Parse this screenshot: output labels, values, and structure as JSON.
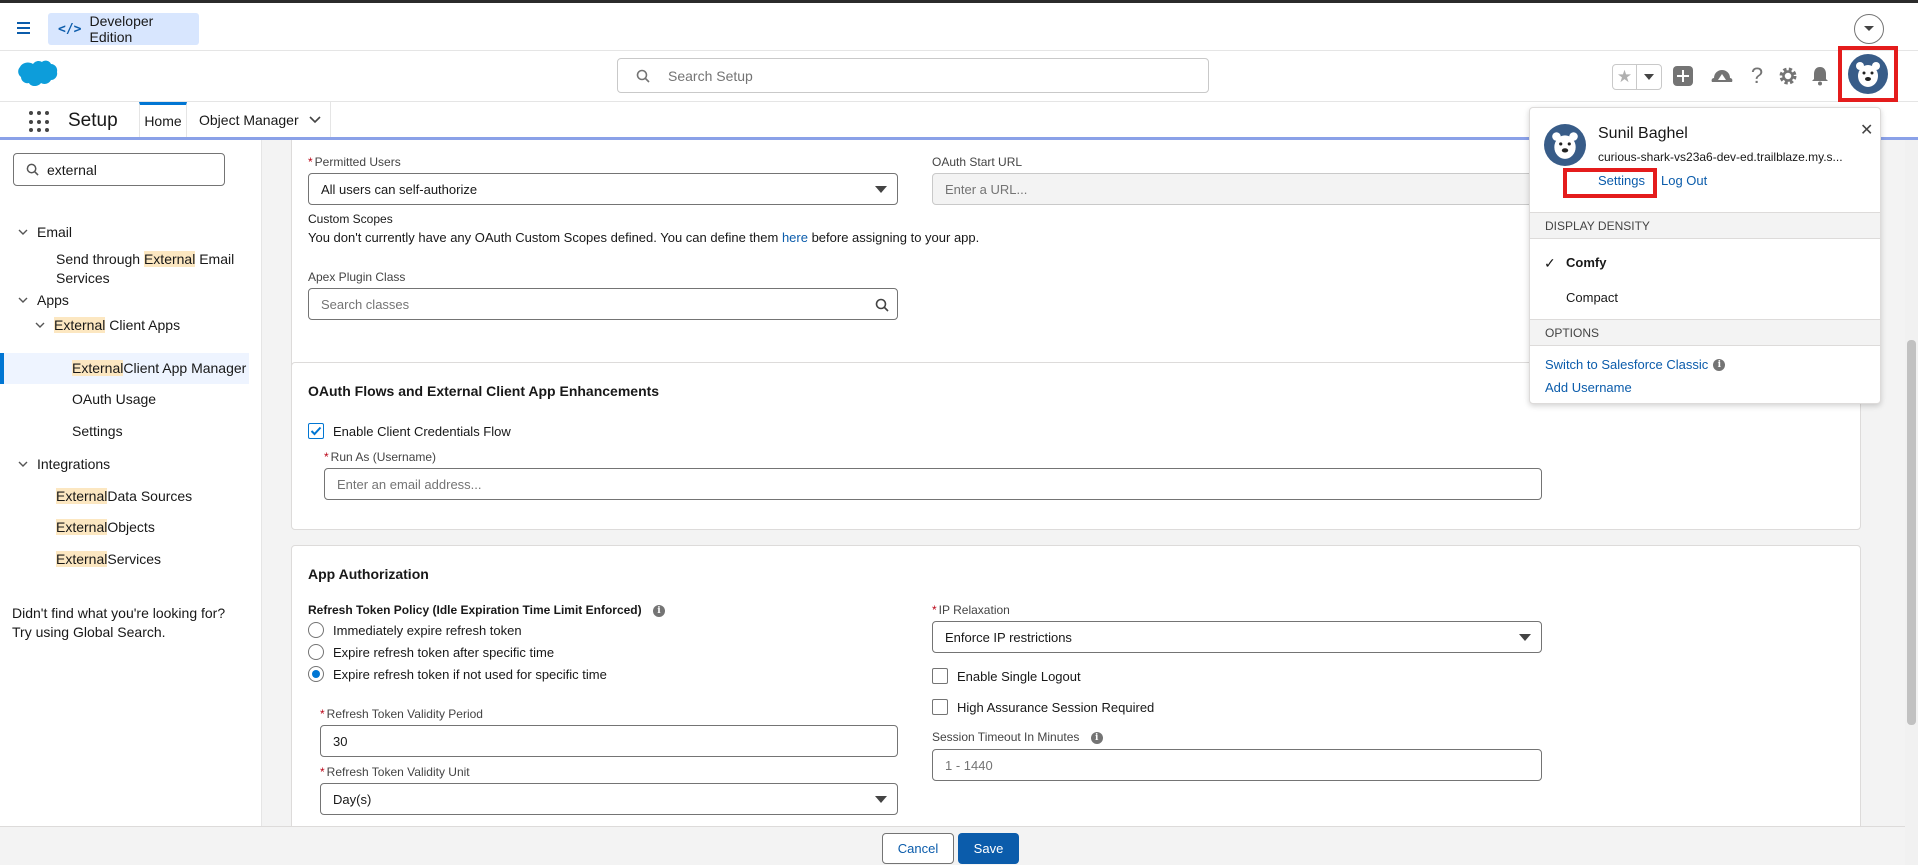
{
  "topbar": {
    "edition_label": "Developer Edition",
    "edition_icon": "</>"
  },
  "header": {
    "search_placeholder": "Search Setup"
  },
  "context_nav": {
    "app_title": "Setup",
    "tabs": [
      {
        "label": "Home"
      },
      {
        "label": "Object Manager"
      }
    ]
  },
  "sidebar": {
    "quick_find_value": "external",
    "tree": {
      "email": "Email",
      "email_child_pre": "Send through ",
      "email_child_hl": "External",
      "email_child_post": " Email",
      "email_child_line2": "Services",
      "apps": "Apps",
      "ext_client_apps_hl": "External",
      "ext_client_apps_post": " Client Apps",
      "manager_hl": "External",
      "manager_post": " Client App Manager",
      "oauth_usage": "OAuth Usage",
      "settings": "Settings",
      "integrations": "Integrations",
      "ext_ds_hl": "External",
      "ext_ds_post": " Data Sources",
      "ext_obj_hl": "External",
      "ext_obj_post": " Objects",
      "ext_svc_hl": "External",
      "ext_svc_post": " Services"
    },
    "help_text": "Didn't find what you're looking for? Try using Global Search."
  },
  "oauth_settings": {
    "permitted_users_label": "Permitted Users",
    "permitted_users_value": "All users can self-authorize",
    "oauth_start_url_label": "OAuth Start URL",
    "oauth_start_url_placeholder": "Enter a URL...",
    "custom_scopes_label": "Custom Scopes",
    "custom_scopes_text_pre": "You don't currently have any OAuth Custom Scopes defined. You can define them ",
    "custom_scopes_link": "here",
    "custom_scopes_text_post": " before assigning to your app.",
    "apex_plugin_label": "Apex Plugin Class",
    "apex_plugin_placeholder": "Search classes"
  },
  "flows_section": {
    "title": "OAuth Flows and External Client App Enhancements",
    "client_credentials_label": "Enable Client Credentials Flow",
    "client_credentials_checked": true,
    "run_as_label": "Run As (Username)",
    "run_as_placeholder": "Enter an email address..."
  },
  "app_auth": {
    "title": "App Authorization",
    "refresh_policy_label": "Refresh Token Policy (Idle Expiration Time Limit Enforced)",
    "refresh_options": [
      {
        "label": "Immediately expire refresh token",
        "selected": false
      },
      {
        "label": "Expire refresh token after specific time",
        "selected": false
      },
      {
        "label": "Expire refresh token if not used for specific time",
        "selected": true
      }
    ],
    "validity_period_label": "Refresh Token Validity Period",
    "validity_period_value": "30",
    "validity_unit_label": "Refresh Token Validity Unit",
    "validity_unit_value": "Day(s)",
    "ip_relaxation_label": "IP Relaxation",
    "ip_relaxation_value": "Enforce IP restrictions",
    "single_logout_label": "Enable Single Logout",
    "high_assurance_label": "High Assurance Session Required",
    "session_timeout_label": "Session Timeout In Minutes",
    "session_timeout_placeholder": "1 - 1440"
  },
  "footer": {
    "cancel_label": "Cancel",
    "save_label": "Save"
  },
  "user_popover": {
    "name": "Sunil Baghel",
    "org_url": "curious-shark-vs23a6-dev-ed.trailblaze.my.s...",
    "settings_link": "Settings",
    "logout_link": "Log Out",
    "density_header": "DISPLAY DENSITY",
    "density_options": [
      "Comfy",
      "Compact"
    ],
    "density_selected": "Comfy",
    "options_header": "OPTIONS",
    "switch_classic": "Switch to Salesforce Classic",
    "add_username": "Add Username"
  },
  "colors": {
    "brand_blue": "#0b5cab",
    "accent_blue": "#0176d3",
    "highlight": "#fce7c1",
    "annotation_red": "#e41c1c"
  }
}
